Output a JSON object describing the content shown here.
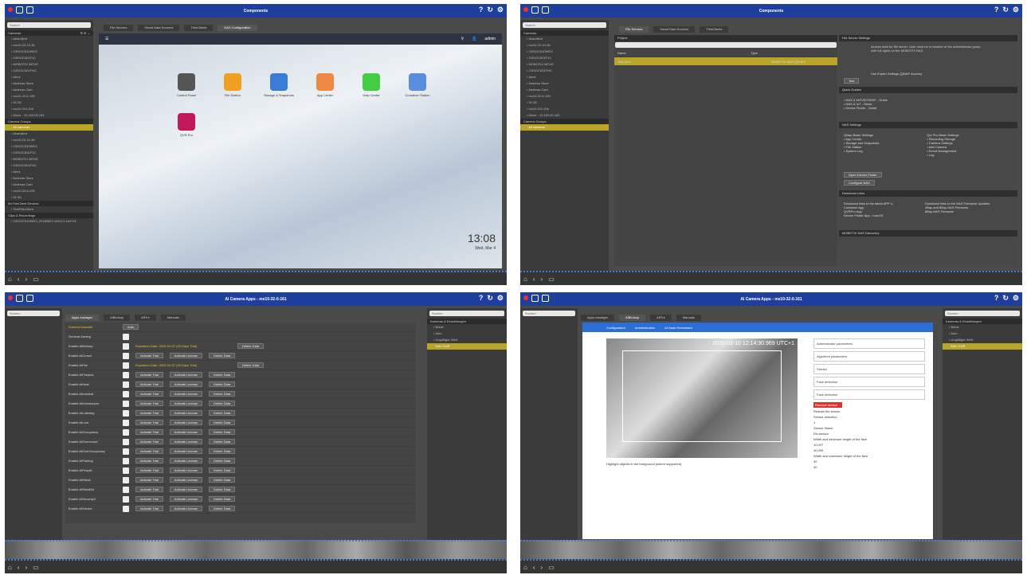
{
  "q1": {
    "title": "Components",
    "search": "Search",
    "cameras": "Cameras",
    "tabs": [
      "File Servers",
      "Smart Data Sources",
      "ThinClients",
      "NAS Configuration"
    ],
    "cam_items": [
      "Ahamilent",
      "mx10-22-10-36",
      "OSSOC510WD3",
      "OSSOC501F10",
      "MOBOTIX MOVE",
      "OSSOC501FHC",
      "Ahmi",
      "Andreas Store",
      "Andreas Cam",
      "mx10-22-6-199",
      "51.55",
      "mx10.201.206",
      "Move - 10.160.00.169"
    ],
    "groups": "Camera Groups",
    "all": "All cameras",
    "nas_user": "admin",
    "apps": [
      "Control Panel",
      "File Station",
      "Storage & Snapshots",
      "App Center",
      "Help Center",
      "Container Station",
      "QVR Pro"
    ],
    "tooltip": "File Station",
    "time": "13:08",
    "date": "Wed, Mar 4",
    "thin": "MxThinClient Devices",
    "thin_item": "TestThinClient",
    "clips": "Clips & Recordings",
    "clip_item": "OSSOC510WD3_20180523-164121-164741"
  },
  "q2": {
    "title": "Components",
    "cols": [
      "Project",
      "Name",
      "Type"
    ],
    "nas_row": {
      "name": "Test NAS",
      "type": "MOBOTIX NAS (QNAP)"
    },
    "sections": [
      "File Server Settings",
      "Quick Guides",
      "NAS Settings",
      "Download Links",
      "MOBOTIX NAS Discovery"
    ],
    "fss_text": "Access data for file server. User must be a member of the administrator group with full rights on the MOBOTIX NAS",
    "expert": "Use Expert Settings (QNAP Access)",
    "test": "Test",
    "guides": [
      "• NAS & MOVE/ONVIF - Guide",
      "• NAS & IoT - Guide",
      "• Device Finder - Guide"
    ],
    "basic": [
      "QNap Basic Settings",
      "• App Center",
      "• Storage and Snapshots",
      "• File Station",
      "• System Log"
    ],
    "pro": [
      "Qvr Pro Basic Settings",
      "• Recording Storage",
      "• Camera Settings",
      "• Add Camera",
      "• Event Management",
      "• Log"
    ],
    "btns": [
      "Open Device Finder",
      "Configure NAS"
    ],
    "dl_left": [
      "Download links to the latest APP´s:",
      "Container App",
      "QVRPro App",
      "Device Finder App - macOS"
    ],
    "dl_right": [
      "Download links to the NAS Firmware Updates:",
      "4Bay and 8Bay NAS Firmware",
      "8Bay NAS Firmware"
    ]
  },
  "q3": {
    "title": "AI Camera Apps - mx10-32-0-161",
    "search": "Suchen",
    "tabs": [
      "Apps manager",
      "AIBioIsop",
      "AIFire",
      "Manuals"
    ],
    "rows": [
      {
        "l": "Kamera Auswahl",
        "v": "Auto"
      },
      {
        "l": "General Arming"
      },
      {
        "l": "Enable AIBioIsop",
        "exp": "Expiration Date: 2020-03-07  (30 Days Trial)"
      },
      {
        "l": "Enable AICrowd"
      },
      {
        "l": "Enable AIFire",
        "exp": "Expiration Date: 2020-03-07  (30 Days Trial)"
      },
      {
        "l": "Enable AIFireplus"
      },
      {
        "l": "Enable AIHeat"
      },
      {
        "l": "Enable AIIncident"
      },
      {
        "l": "Enable AIIntrusionpro"
      },
      {
        "l": "Enable AILoitering"
      },
      {
        "l": "Enable AILoot"
      },
      {
        "l": "Enable AIOccupancy"
      },
      {
        "l": "Enable AIOvercrowd"
      },
      {
        "l": "Enable AIOverOccupancy"
      },
      {
        "l": "Enable AIParking"
      },
      {
        "l": "Enable AIPeople"
      },
      {
        "l": "Enable AIRetail"
      },
      {
        "l": "Enable AIRetail3d"
      },
      {
        "l": "Enable AISecurity3"
      },
      {
        "l": "Enable AISmoke"
      }
    ],
    "activate_trial": "Activate Trial",
    "activate_license": "Activate License",
    "delete": "Delete Data",
    "right_head": "Kameras & Einstellungen",
    "right_items": [
      "Beide",
      "Auto",
      "Ungültiger Wert",
      "Kein GUR"
    ]
  },
  "q4": {
    "title": "AI Camera Apps - mx10-32-0-161",
    "tabs": [
      "Apps manager",
      "AIBioIsop",
      "AIFire",
      "Manuals"
    ],
    "nav": [
      "Configuration",
      "Administration",
      "AI Dash Embedded"
    ],
    "stamp": "2020-02-10 12:14:30.969 UTC+1",
    "panel": [
      "Administrator parameters",
      "Algorithm parameters",
      "Stream",
      "Face detection",
      "Face detection"
    ],
    "remove": "Remove sensor",
    "redraw": "Redraw the sensor",
    "sel": "Sensor selection",
    "sel_v": "1",
    "sname": "Sensor Name",
    "sname_v": "Ein sensor",
    "w1": "Width and minimum height of the face",
    "w1a": "10,007",
    "w1b": "40,099",
    "w2": "Width and maximum height of the face",
    "w2a": "30",
    "w2b": "30",
    "hl": "Highlight objects in the foreground (where supported)"
  }
}
